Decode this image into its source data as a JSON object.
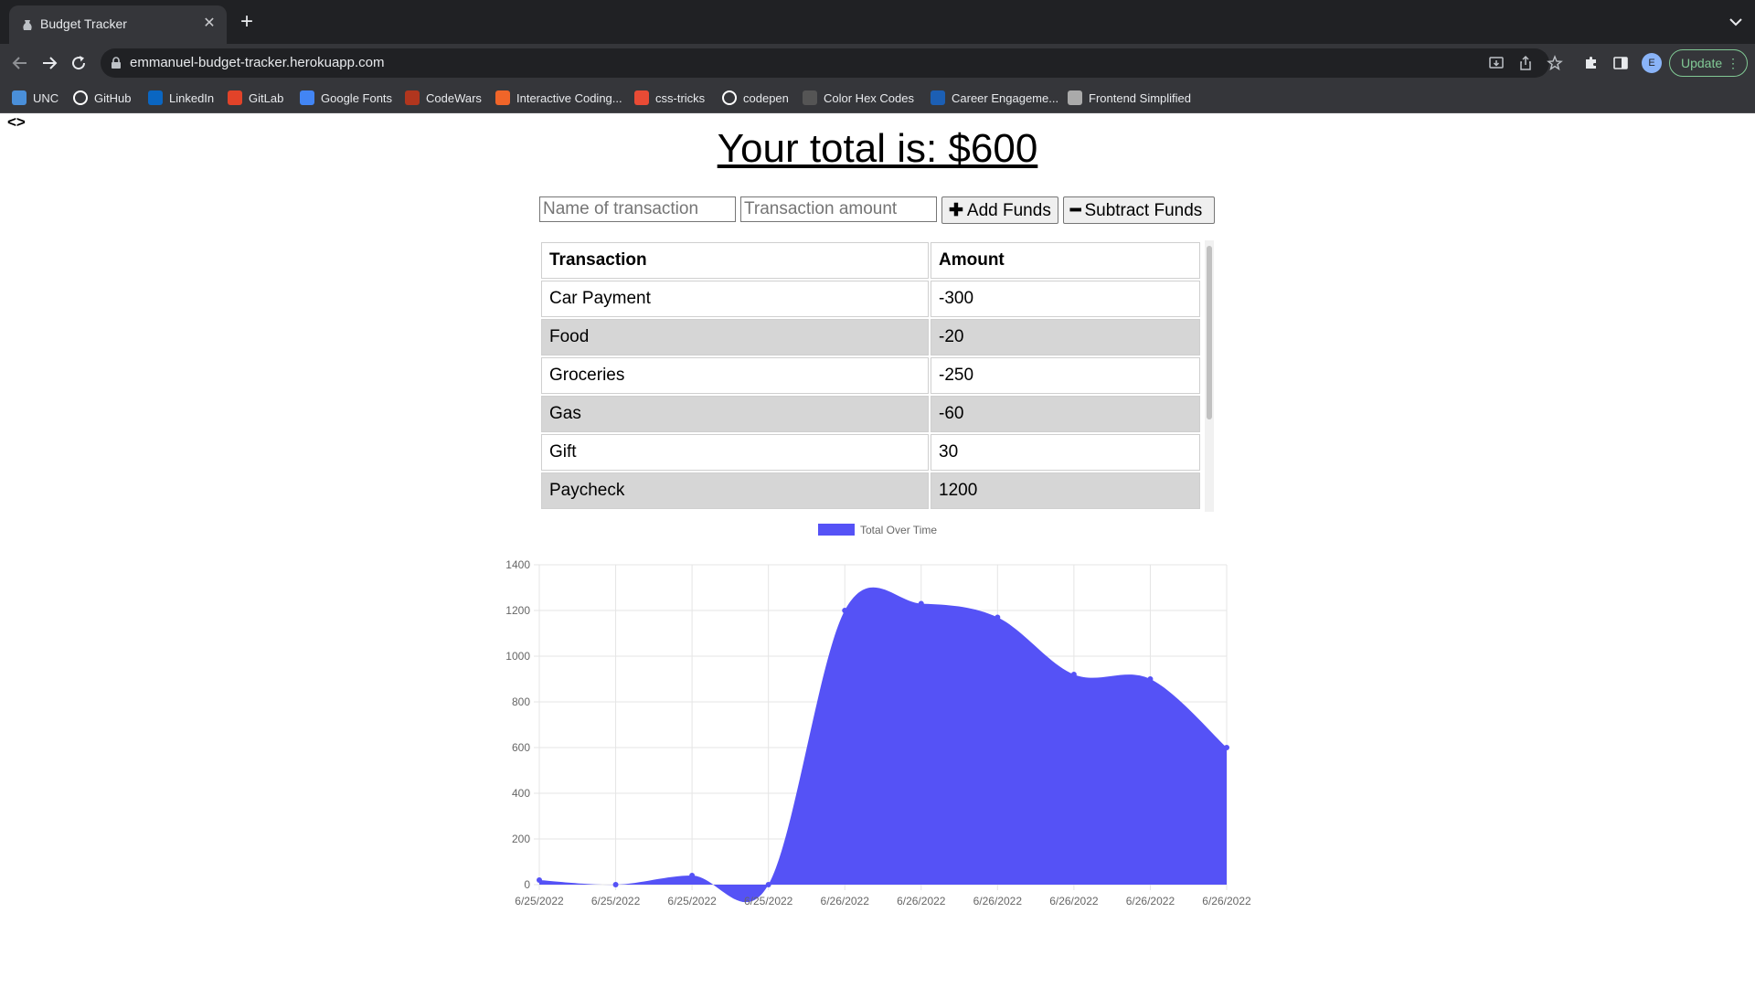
{
  "browser": {
    "tab_title": "Budget Tracker",
    "url": "emmanuel-budget-tracker.herokuapp.com",
    "profile_initial": "E",
    "update_label": "Update",
    "bookmarks": [
      {
        "label": "UNC",
        "icon": "unc-icon",
        "color": "#4a8fd9"
      },
      {
        "label": "GitHub",
        "icon": "github-icon",
        "color": "#ffffff"
      },
      {
        "label": "LinkedIn",
        "icon": "linkedin-icon",
        "color": "#0a66c2"
      },
      {
        "label": "GitLab",
        "icon": "gitlab-icon",
        "color": "#e24329"
      },
      {
        "label": "Google Fonts",
        "icon": "google-fonts-icon",
        "color": "#4285f4"
      },
      {
        "label": "CodeWars",
        "icon": "codewars-icon",
        "color": "#b1361e"
      },
      {
        "label": "Interactive Coding...",
        "icon": "interactive-coding-icon",
        "color": "#f06529"
      },
      {
        "label": "css-tricks",
        "icon": "css-tricks-icon",
        "color": "#e94b35"
      },
      {
        "label": "codepen",
        "icon": "codepen-icon",
        "color": "#ffffff"
      },
      {
        "label": "Color Hex Codes",
        "icon": "color-hex-icon",
        "color": "#555555"
      },
      {
        "label": "Career Engageme...",
        "icon": "career-engagement-icon",
        "color": "#1c5fb4"
      },
      {
        "label": "Frontend Simplified",
        "icon": "frontend-simplified-icon",
        "color": "#aaaaaa"
      }
    ]
  },
  "page": {
    "corner_mark": "<>",
    "total_text": "Your total is: $600",
    "name_placeholder": "Name of transaction",
    "amount_placeholder": "Transaction amount",
    "add_button": "Add Funds",
    "subtract_button": "Subtract Funds",
    "table": {
      "headers": [
        "Transaction",
        "Amount"
      ],
      "rows": [
        [
          "Car Payment",
          "-300"
        ],
        [
          "Food",
          "-20"
        ],
        [
          "Groceries",
          "-250"
        ],
        [
          "Gas",
          "-60"
        ],
        [
          "Gift",
          "30"
        ],
        [
          "Paycheck",
          "1200"
        ]
      ]
    }
  },
  "chart_data": {
    "type": "area",
    "legend_position": "top",
    "x": [
      "6/25/2022",
      "6/25/2022",
      "6/25/2022",
      "6/25/2022",
      "6/26/2022",
      "6/26/2022",
      "6/26/2022",
      "6/26/2022",
      "6/26/2022",
      "6/26/2022"
    ],
    "series": [
      {
        "name": "Total Over Time",
        "values": [
          20,
          0,
          40,
          0,
          1200,
          1230,
          1170,
          920,
          900,
          600
        ],
        "color": "#5552f6"
      }
    ],
    "ylim": [
      0,
      1400
    ],
    "yticks": [
      0,
      200,
      400,
      600,
      800,
      1000,
      1200,
      1400
    ],
    "grid": true
  }
}
